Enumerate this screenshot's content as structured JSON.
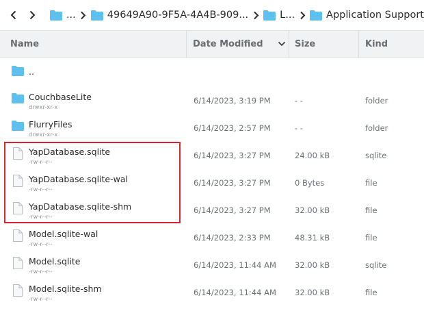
{
  "breadcrumb": {
    "items": [
      {
        "label": "..."
      },
      {
        "label": "49649A90-9F5A-4A4B-909..."
      },
      {
        "label": "L..."
      },
      {
        "label": "Application Support"
      }
    ]
  },
  "columns": {
    "name": "Name",
    "date": "Date Modified",
    "size": "Size",
    "kind": "Kind"
  },
  "rows": [
    {
      "name": "..",
      "perm": "",
      "date": "",
      "size": "",
      "kind": "",
      "type": "folder"
    },
    {
      "name": "CouchbaseLite",
      "perm": "drwxr-xr-x",
      "date": "6/14/2023, 3:19 PM",
      "size": "- -",
      "kind": "folder",
      "type": "folder"
    },
    {
      "name": "FlurryFiles",
      "perm": "drwxr-xr-x",
      "date": "6/14/2023, 2:57 PM",
      "size": "- -",
      "kind": "folder",
      "type": "folder"
    },
    {
      "name": "YapDatabase.sqlite",
      "perm": "-rw-r--r--",
      "date": "6/14/2023, 3:27 PM",
      "size": "24.00 kB",
      "kind": "sqlite",
      "type": "file"
    },
    {
      "name": "YapDatabase.sqlite-wal",
      "perm": "-rw-r--r--",
      "date": "6/14/2023, 3:27 PM",
      "size": "0 Bytes",
      "kind": "file",
      "type": "file"
    },
    {
      "name": "YapDatabase.sqlite-shm",
      "perm": "-rw-r--r--",
      "date": "6/14/2023, 3:27 PM",
      "size": "32.00 kB",
      "kind": "file",
      "type": "file"
    },
    {
      "name": "Model.sqlite-wal",
      "perm": "-rw-r--r--",
      "date": "6/14/2023, 2:33 PM",
      "size": "48.31 kB",
      "kind": "file",
      "type": "file"
    },
    {
      "name": "Model.sqlite",
      "perm": "-rw-r--r--",
      "date": "6/14/2023, 11:44 AM",
      "size": "32.00 kB",
      "kind": "sqlite",
      "type": "file"
    },
    {
      "name": "Model.sqlite-shm",
      "perm": "-rw-r--r--",
      "date": "6/14/2023, 11:44 AM",
      "size": "32.00 kB",
      "kind": "file",
      "type": "file"
    }
  ],
  "colors": {
    "folder": "#5ec0ee",
    "highlight": "#d9232e",
    "header_bg": "#f1f2f3"
  }
}
